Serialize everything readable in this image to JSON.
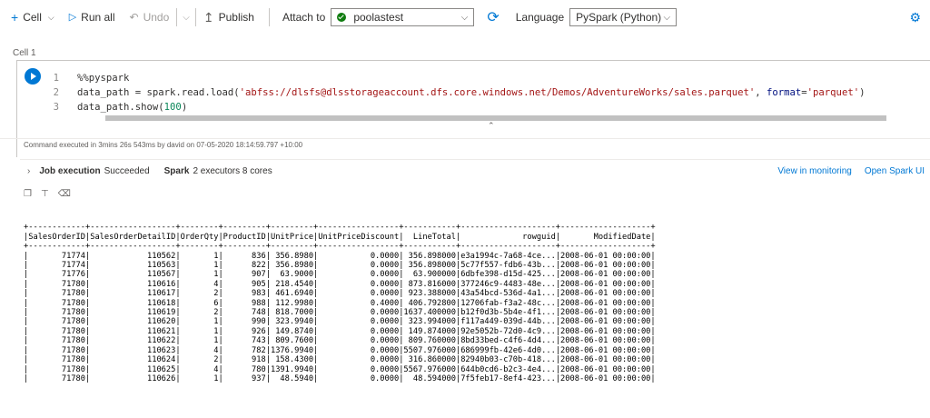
{
  "toolbar": {
    "cell": "Cell",
    "run_all": "Run all",
    "undo": "Undo",
    "publish": "Publish",
    "attach_to": "Attach to",
    "attach_value": "poolastest",
    "language": "Language",
    "language_value": "PySpark (Python)"
  },
  "cell": {
    "label": "Cell 1",
    "lines": [
      {
        "n": "1",
        "text": "%%pyspark"
      },
      {
        "n": "2",
        "pre": "data_path = spark.read.load(",
        "str": "'abfss://dlsfs@dlsstorageaccount.dfs.core.windows.net/Demos/AdventureWorks/sales.parquet'",
        "mid": ", ",
        "kw": "format",
        "eq": "=",
        "str2": "'parquet'",
        "post": ")"
      },
      {
        "n": "3",
        "pre": "data_path.show(",
        "num": "100",
        "post": ")"
      }
    ]
  },
  "exec": "Command executed in 3mins 26s 543ms by david on 07-05-2020 18:14:59.797 +10:00",
  "job": {
    "label": "Job execution",
    "status": "Succeeded",
    "spark": "Spark",
    "detail": "2 executors 8 cores",
    "view": "View in monitoring",
    "open": "Open Spark UI"
  },
  "table": {
    "sep": "+------------+------------------+--------+---------+---------+-----------------+-----------+--------------------+-------------------+",
    "header": "|SalesOrderID|SalesOrderDetailID|OrderQty|ProductID|UnitPrice|UnitPriceDiscount|  LineTotal|             rowguid|       ModifiedDate|",
    "rows": [
      "|       71774|            110562|       1|      836| 356.8980|           0.0000| 356.898000|e3a1994c-7a68-4ce...|2008-06-01 00:00:00|",
      "|       71774|            110563|       1|      822| 356.8980|           0.0000| 356.898000|5c77f557-fdb6-43b...|2008-06-01 00:00:00|",
      "|       71776|            110567|       1|      907|  63.9000|           0.0000|  63.900000|6dbfe398-d15d-425...|2008-06-01 00:00:00|",
      "|       71780|            110616|       4|      905| 218.4540|           0.0000| 873.816000|377246c9-4483-48e...|2008-06-01 00:00:00|",
      "|       71780|            110617|       2|      983| 461.6940|           0.0000| 923.388000|43a54bcd-536d-4a1...|2008-06-01 00:00:00|",
      "|       71780|            110618|       6|      988| 112.9980|           0.4000| 406.792800|12706fab-f3a2-48c...|2008-06-01 00:00:00|",
      "|       71780|            110619|       2|      748| 818.7000|           0.0000|1637.400000|b12f0d3b-5b4e-4f1...|2008-06-01 00:00:00|",
      "|       71780|            110620|       1|      990| 323.9940|           0.0000| 323.994000|f117a449-039d-44b...|2008-06-01 00:00:00|",
      "|       71780|            110621|       1|      926| 149.8740|           0.0000| 149.874000|92e5052b-72d0-4c9...|2008-06-01 00:00:00|",
      "|       71780|            110622|       1|      743| 809.7600|           0.0000| 809.760000|8bd33bed-c4f6-4d4...|2008-06-01 00:00:00|",
      "|       71780|            110623|       4|      782|1376.9940|           0.0000|5507.976000|686999fb-42e6-4d0...|2008-06-01 00:00:00|",
      "|       71780|            110624|       2|      918| 158.4300|           0.0000| 316.860000|82940b03-c70b-418...|2008-06-01 00:00:00|",
      "|       71780|            110625|       4|      780|1391.9940|           0.0000|5567.976000|644b0cd6-b2c3-4e4...|2008-06-01 00:00:00|",
      "|       71780|            110626|       1|      937|  48.5940|           0.0000|  48.594000|7f5feb17-8ef4-423...|2008-06-01 00:00:00|"
    ]
  }
}
